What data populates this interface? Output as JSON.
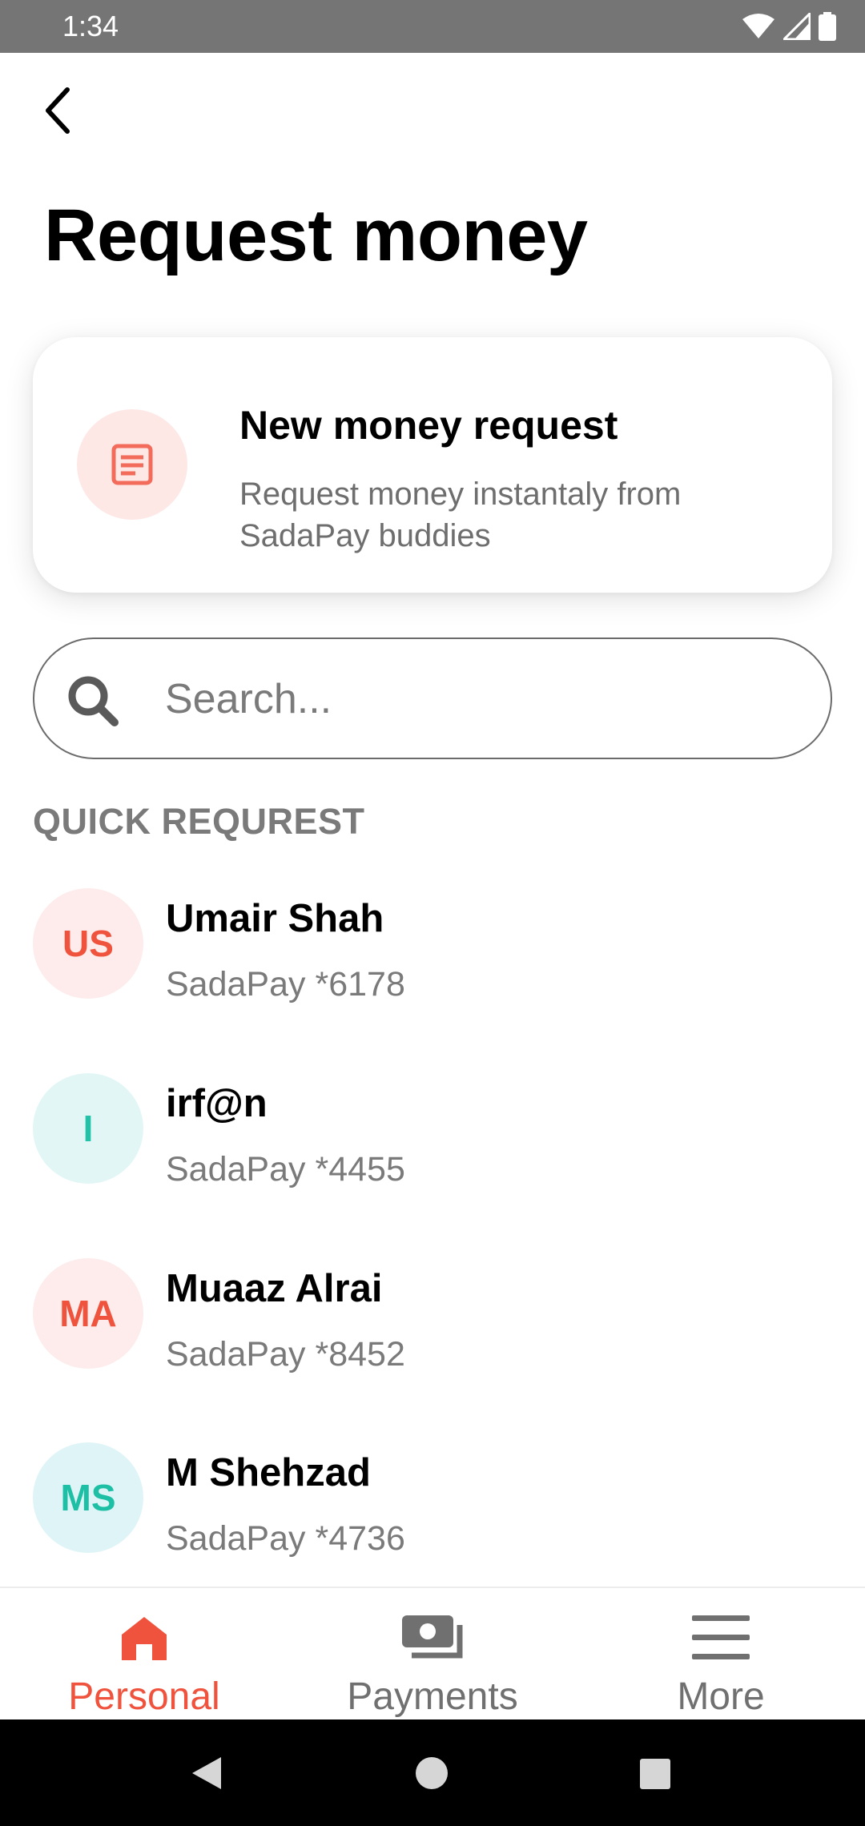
{
  "status_bar": {
    "time": "1:34"
  },
  "header": {
    "title": "Request money"
  },
  "new_request": {
    "title": "New money request",
    "subtitle": "Request money instantaly from SadaPay buddies"
  },
  "search": {
    "placeholder": "Search..."
  },
  "section_label": "QUICK REQUREST",
  "contacts": [
    {
      "initials": "US",
      "name": "Umair Shah",
      "account": "SadaPay *6178"
    },
    {
      "initials": "I",
      "name": "irf@n",
      "account": "SadaPay *4455"
    },
    {
      "initials": "MA",
      "name": "Muaaz Alrai",
      "account": "SadaPay *8452"
    },
    {
      "initials": "MS",
      "name": "M Shehzad",
      "account": "SadaPay *4736"
    }
  ],
  "bottom_nav": [
    {
      "label": "Personal",
      "icon": "home-icon",
      "active": true
    },
    {
      "label": "Payments",
      "icon": "cash-icon",
      "active": false
    },
    {
      "label": "More",
      "icon": "menu-icon",
      "active": false
    }
  ],
  "colors": {
    "accent": "#f0533d",
    "teal": "#22c2a8",
    "status_bar": "#757575",
    "muted_text": "#7a7a7a"
  }
}
